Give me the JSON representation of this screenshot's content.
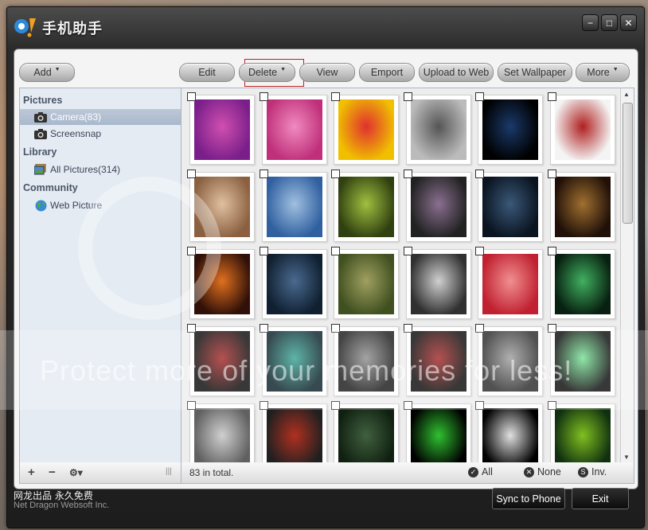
{
  "window": {
    "title": "手机助手",
    "buttons": {
      "minimize": "−",
      "maximize": "□",
      "close": "✕"
    }
  },
  "toolbar": {
    "add": "Add",
    "edit": "Edit",
    "delete": "Delete",
    "view": "View",
    "emport": "Emport",
    "upload": "Upload to Web",
    "wallpaper": "Set Wallpaper",
    "more": "More"
  },
  "sidebar": {
    "pictures_header": "Pictures",
    "camera": "Camera(83)",
    "screensnap": "Screensnap",
    "library_header": "Library",
    "all_pictures": "All Pictures(314)",
    "community_header": "Community",
    "web_picture": "Web Picture",
    "add_symbol": "+",
    "remove_symbol": "−",
    "settings_symbol": "⚙▾",
    "grip": "|||"
  },
  "grid": {
    "icons": [
      "purple-circuit-image",
      "pink-floral-image",
      "smiley-faces-image",
      "why-so-serious-image",
      "phone-screen-image",
      "sports-car-image",
      "girl-portrait-image",
      "armored-knight-image",
      "green-warrior-image",
      "dark-abstract-image",
      "joker-image",
      "mario-image",
      "soldier-image",
      "alien-image",
      "master-chief-image",
      "robot-warrior-image",
      "dont-care-image",
      "green-lantern-image",
      "iron-man-image",
      "glowing-logo-image",
      "batman-image",
      "red-logo-image",
      "apple-logo-image",
      "green-light-image",
      "silver-car-image",
      "terminator-image",
      "dark-forest-image",
      "matrix-code-image",
      "glowing-apple-image",
      "green-apple-image"
    ],
    "colors": [
      [
        "#7a1f8a",
        "#d04fb0"
      ],
      [
        "#c0307a",
        "#f08ac0"
      ],
      [
        "#f0c000",
        "#e03030"
      ],
      [
        "#bbbbbb",
        "#555555"
      ],
      [
        "#000000",
        "#1a3a6a"
      ],
      [
        "#f4f4f4",
        "#b02020"
      ],
      [
        "#8a6040",
        "#e0c0a0"
      ],
      [
        "#3060a0",
        "#a0c0e0"
      ],
      [
        "#304010",
        "#a0c040"
      ],
      [
        "#222222",
        "#8a7090"
      ],
      [
        "#0a1420",
        "#3a5878"
      ],
      [
        "#201008",
        "#a07030"
      ],
      [
        "#301008",
        "#e07020"
      ],
      [
        "#102030",
        "#4a6a90"
      ],
      [
        "#405020",
        "#a0a060"
      ],
      [
        "#303030",
        "#d0d0d0"
      ],
      [
        "#c02030",
        "#f09090"
      ],
      [
        "#082010",
        "#40b060"
      ],
      [
        "#000000",
        "#a02020"
      ],
      [
        "#001820",
        "#30a090"
      ],
      [
        "#101010",
        "#8a8a8a"
      ],
      [
        "#000000",
        "#a02020"
      ],
      [
        "#202020",
        "#9a9a9a"
      ],
      [
        "#000000",
        "#70e090"
      ],
      [
        "#606060",
        "#d0d0d0"
      ],
      [
        "#202020",
        "#b03020"
      ],
      [
        "#102010",
        "#406040"
      ],
      [
        "#000000",
        "#30c030"
      ],
      [
        "#000000",
        "#e0e0e0"
      ],
      [
        "#103010",
        "#80c020"
      ]
    ]
  },
  "status": {
    "count": "83 in total.",
    "all": "All",
    "none": "None",
    "inv": "Inv."
  },
  "footer": {
    "cn": "网龙出品 永久免费",
    "en": "Net Dragon Websoft Inc.",
    "sync": "Sync to Phone",
    "exit": "Exit"
  },
  "watermark": {
    "text": "Protect more of your memories for less!"
  }
}
